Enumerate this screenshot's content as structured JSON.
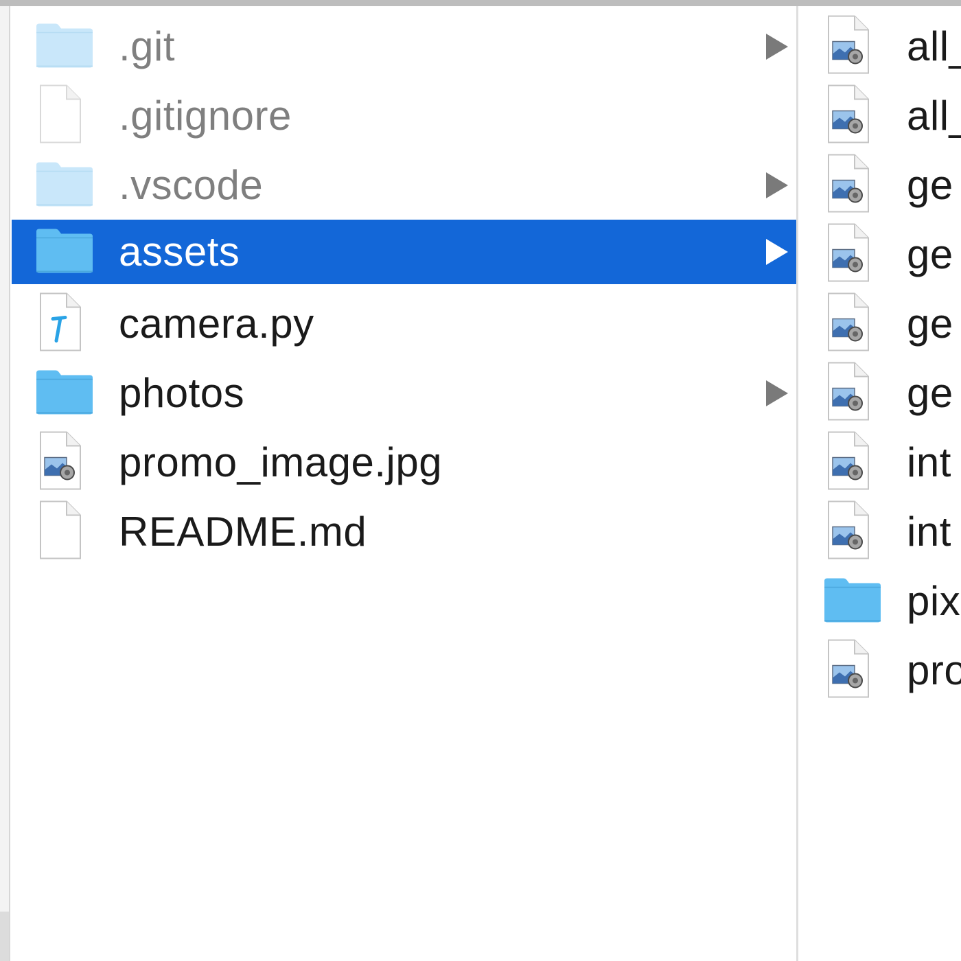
{
  "colors": {
    "selection": "#1367d8",
    "folder": "#5fbdf2",
    "folder_dim": "#c9e7fa",
    "text": "#1a1a1a",
    "text_dim": "#7f7f7f"
  },
  "columns": [
    {
      "items": [
        {
          "name": ".git",
          "kind": "folder",
          "icon": "folder-icon",
          "dim": true,
          "has_children": true,
          "selected": false
        },
        {
          "name": ".gitignore",
          "kind": "file",
          "icon": "document-icon",
          "dim": true,
          "has_children": false,
          "selected": false
        },
        {
          "name": ".vscode",
          "kind": "folder",
          "icon": "folder-icon",
          "dim": true,
          "has_children": true,
          "selected": false
        },
        {
          "name": "assets",
          "kind": "folder",
          "icon": "folder-icon",
          "dim": false,
          "has_children": true,
          "selected": true
        },
        {
          "name": "camera.py",
          "kind": "python",
          "icon": "python-file-icon",
          "dim": false,
          "has_children": false,
          "selected": false
        },
        {
          "name": "photos",
          "kind": "folder",
          "icon": "folder-icon",
          "dim": false,
          "has_children": true,
          "selected": false
        },
        {
          "name": "promo_image.jpg",
          "kind": "image",
          "icon": "image-file-icon",
          "dim": false,
          "has_children": false,
          "selected": false
        },
        {
          "name": "README.md",
          "kind": "file",
          "icon": "document-icon",
          "dim": false,
          "has_children": false,
          "selected": false
        }
      ]
    },
    {
      "items": [
        {
          "name": "all_",
          "kind": "image",
          "icon": "image-file-icon"
        },
        {
          "name": "all_",
          "kind": "image",
          "icon": "image-file-icon"
        },
        {
          "name": "ge",
          "kind": "image",
          "icon": "image-file-icon"
        },
        {
          "name": "ge",
          "kind": "image",
          "icon": "image-file-icon"
        },
        {
          "name": "ge",
          "kind": "image",
          "icon": "image-file-icon"
        },
        {
          "name": "ge",
          "kind": "image",
          "icon": "image-file-icon"
        },
        {
          "name": "int",
          "kind": "image",
          "icon": "image-file-icon"
        },
        {
          "name": "int",
          "kind": "image",
          "icon": "image-file-icon"
        },
        {
          "name": "pix",
          "kind": "folder",
          "icon": "folder-icon"
        },
        {
          "name": "pro",
          "kind": "image",
          "icon": "image-file-icon"
        }
      ]
    }
  ]
}
